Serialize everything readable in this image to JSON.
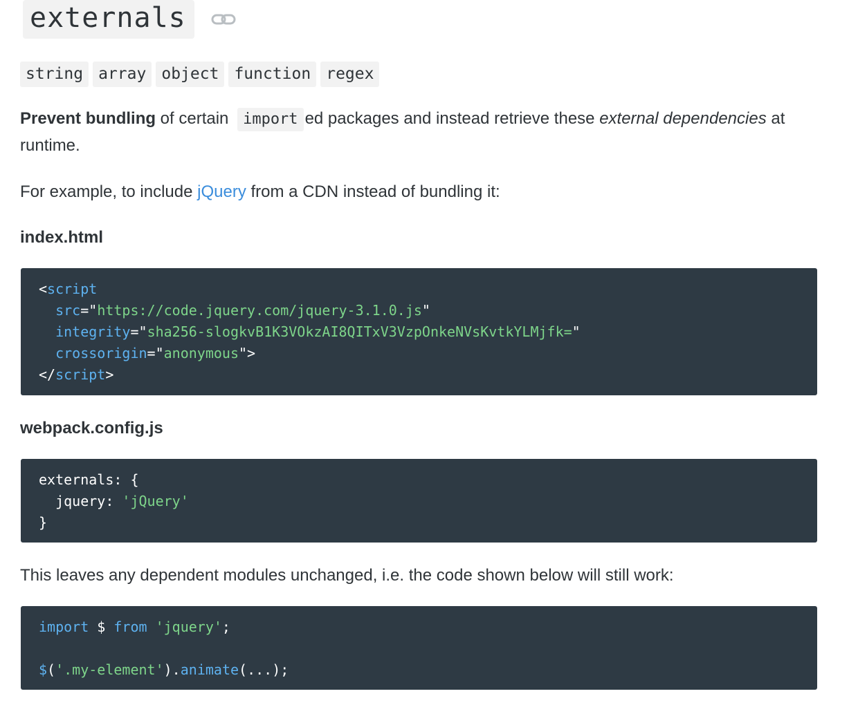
{
  "heading": {
    "title": "externals",
    "anchor_icon": "link-icon"
  },
  "types": [
    "string",
    "array",
    "object",
    "function",
    "regex"
  ],
  "intro": {
    "bold": "Prevent bundling",
    "text1": " of certain ",
    "code": "import",
    "text2": "ed packages and instead retrieve these ",
    "em": "external dependencies",
    "text3": " at runtime."
  },
  "example": {
    "text1": "For example, to include ",
    "link": "jQuery",
    "text2": " from a CDN instead of bundling it:"
  },
  "file1": "index.html",
  "file2": "webpack.config.js",
  "code1": {
    "l1_open": "<",
    "l1_tag": "script",
    "l2_attr": "src",
    "l2_eq": "=\"",
    "l2_val": "https://code.jquery.com/jquery-3.1.0.js",
    "l2_close": "\"",
    "l3_attr": "integrity",
    "l3_eq": "=\"",
    "l3_val": "sha256-slogkvB1K3VOkzAI8QITxV3VzpOnkeNVsKvtkYLMjfk=",
    "l3_close": "\"",
    "l4_attr": "crossorigin",
    "l4_eq": "=\"",
    "l4_val": "anonymous",
    "l4_close": "\">",
    "l5_open": "</",
    "l5_tag": "script",
    "l5_close": ">"
  },
  "code2": {
    "l1": "externals: {",
    "l2_key": "jquery: ",
    "l2_val": "'jQuery'",
    "l3": "}"
  },
  "leaves": "This leaves any dependent modules unchanged, i.e. the code shown below will still work:",
  "code3": {
    "l1_kw1": "import",
    "l1_mid": " $ ",
    "l1_kw2": "from",
    "l1_sp": " ",
    "l1_str": "'jquery'",
    "l1_end": ";",
    "l3_fn1": "$",
    "l3_p1": "(",
    "l3_str": "'.my-element'",
    "l3_p2": ").",
    "l3_fn2": "animate",
    "l3_end": "(...);"
  }
}
